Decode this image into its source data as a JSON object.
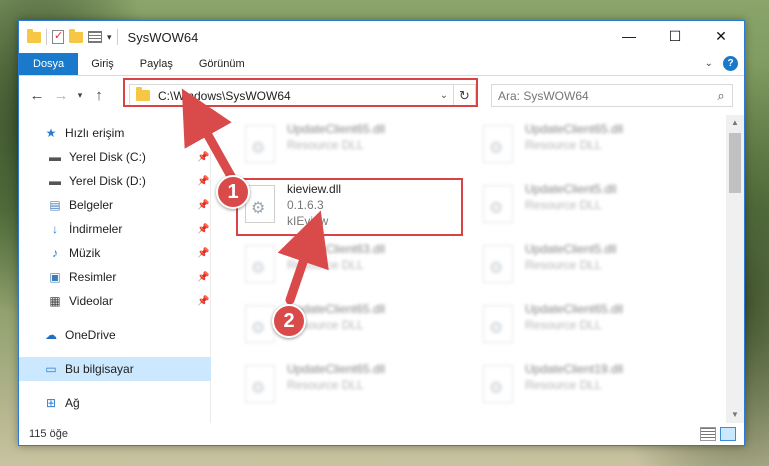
{
  "window": {
    "title": "SysWOW64",
    "controls": {
      "minimize": "—",
      "maximize": "☐",
      "close": "✕"
    }
  },
  "ribbon": {
    "tabs": [
      {
        "label": "Dosya",
        "active": true
      },
      {
        "label": "Giriş"
      },
      {
        "label": "Paylaş"
      },
      {
        "label": "Görünüm"
      }
    ]
  },
  "address": {
    "path": "C:\\Windows\\SysWOW64",
    "search_placeholder": "Ara: SysWOW64"
  },
  "nav": {
    "items": [
      {
        "label": "Hızlı erişim",
        "icon": "star-icon"
      },
      {
        "label": "Yerel Disk (C:)",
        "icon": "drive-icon",
        "pinned": true
      },
      {
        "label": "Yerel Disk (D:)",
        "icon": "drive-icon",
        "pinned": true
      },
      {
        "label": "Belgeler",
        "icon": "documents-icon",
        "pinned": true
      },
      {
        "label": "İndirmeler",
        "icon": "download-icon",
        "pinned": true
      },
      {
        "label": "Müzik",
        "icon": "music-icon",
        "pinned": true
      },
      {
        "label": "Resimler",
        "icon": "pictures-icon",
        "pinned": true
      },
      {
        "label": "Videolar",
        "icon": "videos-icon",
        "pinned": true
      },
      {
        "label": "OneDrive",
        "icon": "cloud-icon"
      },
      {
        "label": "Bu bilgisayar",
        "icon": "computer-icon",
        "selected": true
      },
      {
        "label": "Ağ",
        "icon": "network-icon"
      }
    ]
  },
  "files": {
    "left": [
      {
        "name": "UpdateClient65.dll",
        "desc": "Resource DLL"
      },
      {
        "name": "kieview.dll",
        "version": "0.1.6.3",
        "desc": "kIEview",
        "highlighted": true
      },
      {
        "name": "UpdateClient63.dll",
        "desc": "Resource DLL"
      },
      {
        "name": "UpdateClient65.dll",
        "desc": "Resource DLL"
      },
      {
        "name": "UpdateClient65.dll",
        "desc": "Resource DLL"
      }
    ],
    "right": [
      {
        "name": "UpdateClient65.dll",
        "desc": "Resource DLL"
      },
      {
        "name": "UpdateClient5.dll",
        "desc": "Resource DLL"
      },
      {
        "name": "UpdateClient5.dll",
        "desc": "Resource DLL"
      },
      {
        "name": "UpdateClient65.dll",
        "desc": "Resource DLL"
      },
      {
        "name": "UpdateClient19.dll",
        "desc": "Resource DLL"
      }
    ]
  },
  "status": {
    "count": "115 öğe"
  },
  "annotations": {
    "step1": "1",
    "step2": "2",
    "color": "#d94a4a"
  }
}
